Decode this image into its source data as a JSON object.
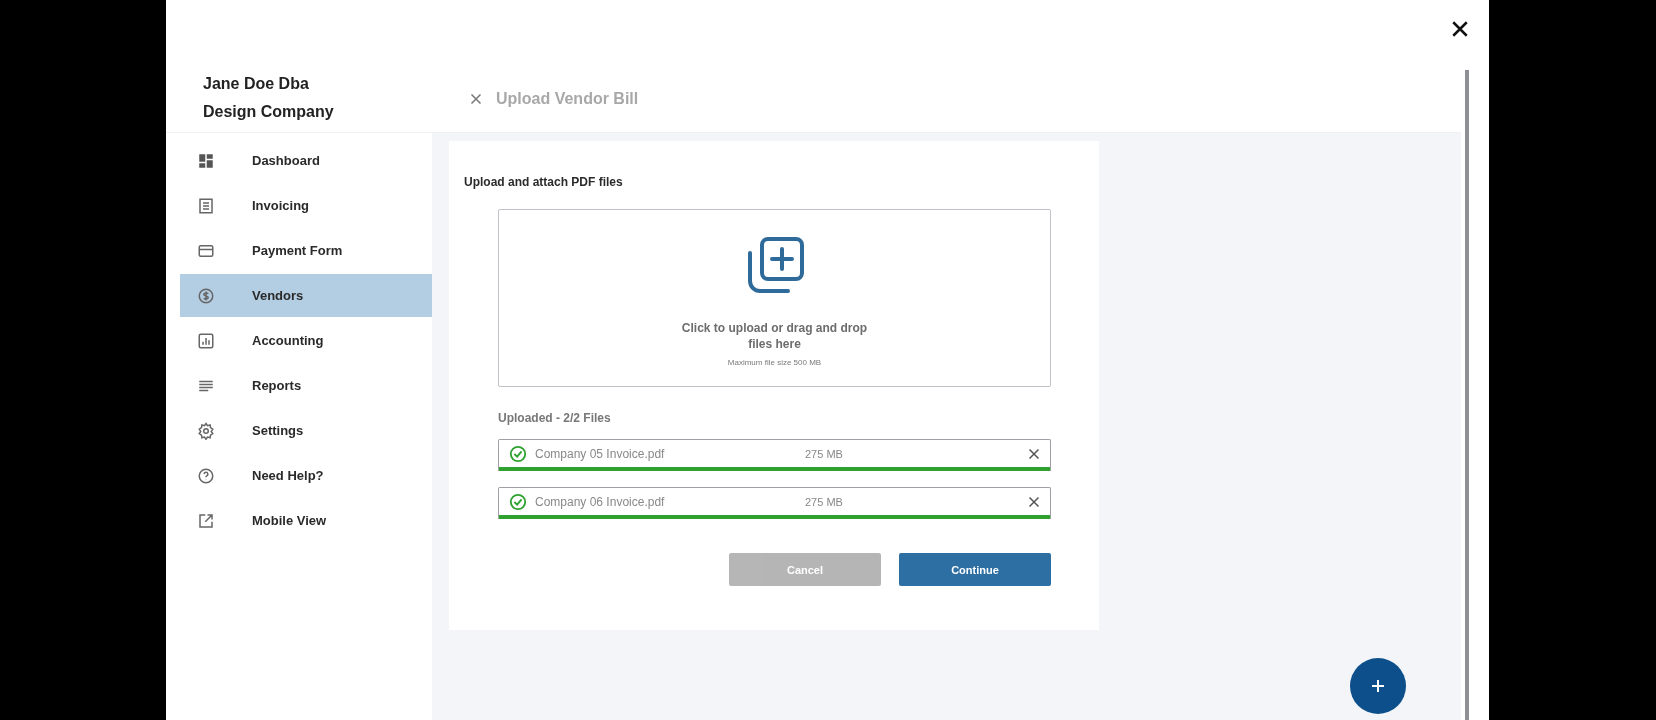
{
  "brand": {
    "line_1": "Jane Doe Dba",
    "line_2": "Design Company"
  },
  "sidebar": {
    "items": [
      {
        "label": "Dashboard",
        "selected": false
      },
      {
        "label": "Invoicing",
        "selected": false
      },
      {
        "label": "Payment Form",
        "selected": false
      },
      {
        "label": "Vendors",
        "selected": true
      },
      {
        "label": "Accounting",
        "selected": false
      },
      {
        "label": "Reports",
        "selected": false
      },
      {
        "label": "Settings",
        "selected": false
      },
      {
        "label": "Need Help?",
        "selected": false
      },
      {
        "label": "Mobile View",
        "selected": false
      }
    ]
  },
  "header": {
    "title": "Upload Vendor Bill"
  },
  "card": {
    "title": "Upload and attach PDF files",
    "dropzone": {
      "text": "Click to upload or drag and drop files here",
      "hint": "Maximum file size 500 MB"
    },
    "uploaded_label": "Uploaded - 2/2 Files",
    "files": [
      {
        "name": "Company 05 Invoice.pdf",
        "size": "275 MB",
        "done": true,
        "level": 1
      },
      {
        "name": "Company 06 Invoice.pdf",
        "size": "275 MB",
        "done": true,
        "level": 1
      }
    ],
    "buttons": [
      {
        "label": "Cancel",
        "kind": "secondary",
        "disabled": true
      },
      {
        "label": "Continue",
        "kind": "primary",
        "disabled": false
      }
    ]
  }
}
